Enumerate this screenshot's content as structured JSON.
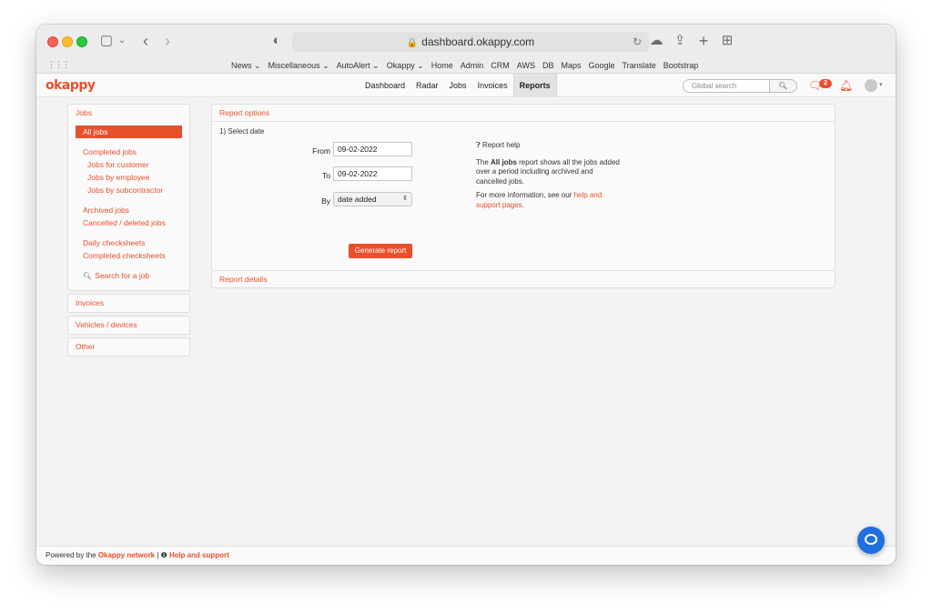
{
  "browser": {
    "url": "dashboard.okappy.com",
    "bookmarks": [
      "News ⌄",
      "Miscellaneous ⌄",
      "AutoAlert ⌄",
      "Okappy ⌄",
      "Home",
      "Admin",
      "CRM",
      "AWS",
      "DB",
      "Maps",
      "Google",
      "Translate",
      "Bootstrap"
    ]
  },
  "app": {
    "logo": "okappy",
    "nav": [
      {
        "label": "Dashboard"
      },
      {
        "label": "Radar"
      },
      {
        "label": "Jobs"
      },
      {
        "label": "Invoices"
      },
      {
        "label": "Reports"
      }
    ],
    "active_nav": "Reports",
    "search_placeholder": "Global search",
    "chat_count": "2"
  },
  "sidebar": {
    "jobs_header": "Jobs",
    "items": {
      "all_jobs": "All jobs",
      "completed_jobs": "Completed jobs",
      "jobs_for_customer": "Jobs for customer",
      "jobs_by_employee": "Jobs by employee",
      "jobs_by_subcontractor": "Jobs by subcontractor",
      "archived_jobs": "Archived jobs",
      "cancelled_jobs": "Cancelled / deleted jobs",
      "daily_checksheets": "Daily checksheets",
      "completed_checksheets": "Completed checksheets",
      "search_job": "Search for a job"
    },
    "invoices": "Invoices",
    "vehicles": "Vehicles / devices",
    "other": "Other"
  },
  "report_options": {
    "title": "Report options",
    "step": "1) Select date",
    "from_label": "From",
    "from_value": "09-02-2022",
    "to_label": "To",
    "to_value": "09-02-2022",
    "by_label": "By",
    "by_value": "date added",
    "generate": "Generate report",
    "help_title": "Report help",
    "help_text_pre": "The ",
    "help_text_bold": "All jobs",
    "help_text_post": " report shows all the jobs added over a period including archived and cancelled jobs.",
    "help_more_pre": "For more information, see our ",
    "help_more_link": "help and support pages",
    "help_more_post": "."
  },
  "report_details": {
    "title": "Report details"
  },
  "footer": {
    "prefix": "Powered by the ",
    "network": "Okappy network",
    "separator": " | ",
    "help": "Help and support"
  },
  "colors": {
    "accent": "#e8502c",
    "fab": "#1f6fe0"
  }
}
